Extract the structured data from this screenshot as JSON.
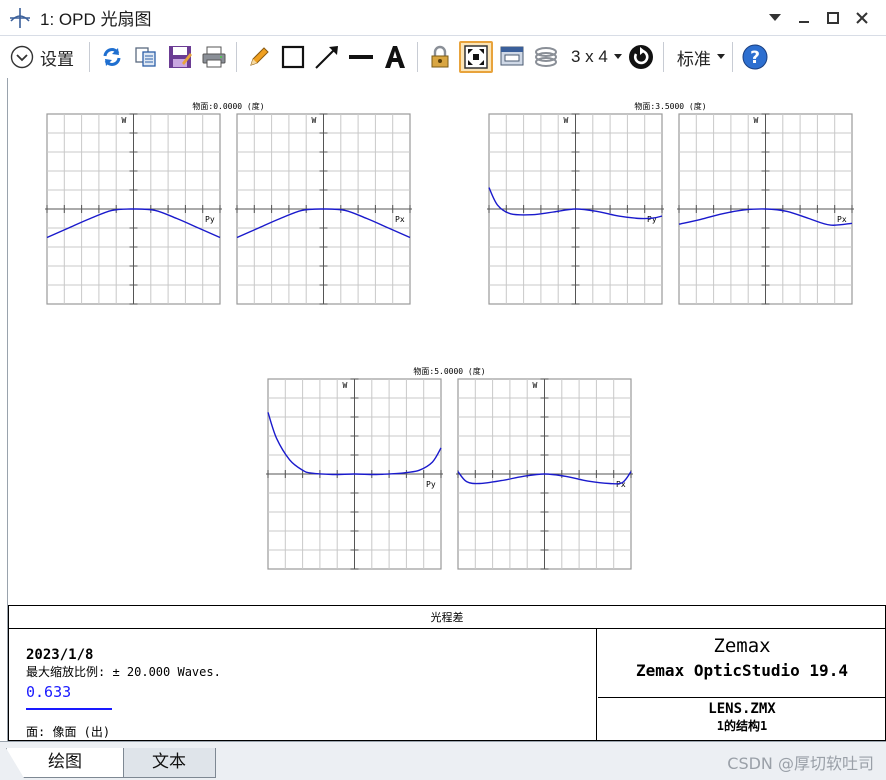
{
  "window": {
    "title": "1: OPD 光扇图"
  },
  "toolbar": {
    "settings_label": "设置",
    "layout_label": "3 x 4",
    "standard_label": "标准",
    "icons": [
      "refresh-icon",
      "copy-icon",
      "save-icon",
      "print-icon",
      "pencil-icon",
      "rectangle-icon",
      "arrow-icon",
      "line-icon",
      "text-icon",
      "lock-icon",
      "window-fit-icon",
      "window-icon",
      "layers-icon",
      "layout-dropdown",
      "rotate-icon",
      "standard-dropdown",
      "help-icon"
    ]
  },
  "fields": [
    {
      "title": "物面:0.0000 (度)",
      "tangential_label": "Py",
      "sagittal_label": "Px",
      "axis_label": "W"
    },
    {
      "title": "物面:3.5000 (度)",
      "tangential_label": "Py",
      "sagittal_label": "Px",
      "axis_label": "W"
    },
    {
      "title": "物面:5.0000 (度)",
      "tangential_label": "Py",
      "sagittal_label": "Px",
      "axis_label": "W"
    }
  ],
  "chart_data": [
    {
      "type": "line",
      "title": "物面:0.0000 (度)",
      "panels": [
        {
          "name": "Py",
          "x": [
            -1,
            -0.75,
            -0.5,
            -0.25,
            0,
            0.25,
            0.5,
            0.75,
            1
          ],
          "y": [
            -6,
            -4,
            -2,
            -0.3,
            0,
            -0.3,
            -2,
            -4,
            -6
          ]
        },
        {
          "name": "Px",
          "x": [
            -1,
            -0.75,
            -0.5,
            -0.25,
            0,
            0.25,
            0.5,
            0.75,
            1
          ],
          "y": [
            -6,
            -4,
            -2,
            -0.3,
            0,
            -0.3,
            -2,
            -4,
            -6
          ]
        }
      ],
      "xlim": [
        -1,
        1
      ],
      "ylim": [
        -20,
        20
      ],
      "ylabel": "W"
    },
    {
      "type": "line",
      "title": "物面:3.5000 (度)",
      "panels": [
        {
          "name": "Py",
          "x": [
            -1,
            -0.9,
            -0.75,
            -0.5,
            -0.25,
            0,
            0.25,
            0.5,
            0.75,
            0.9,
            1
          ],
          "y": [
            4.5,
            0.8,
            -1,
            -1.2,
            -0.6,
            0,
            -0.5,
            -1.5,
            -2,
            -1.9,
            -1.5
          ]
        },
        {
          "name": "Px",
          "x": [
            -1,
            -0.75,
            -0.5,
            -0.25,
            0,
            0.25,
            0.5,
            0.75,
            1
          ],
          "y": [
            -3.2,
            -2.2,
            -1,
            -0.2,
            0,
            -0.5,
            -2,
            -3.4,
            -3
          ]
        }
      ],
      "xlim": [
        -1,
        1
      ],
      "ylim": [
        -20,
        20
      ],
      "ylabel": "W"
    },
    {
      "type": "line",
      "title": "物面:5.0000 (度)",
      "panels": [
        {
          "name": "Py",
          "x": [
            -1,
            -0.9,
            -0.75,
            -0.6,
            -0.5,
            -0.25,
            0,
            0.25,
            0.5,
            0.6,
            0.75,
            0.9,
            1
          ],
          "y": [
            13,
            7.5,
            3,
            0.8,
            0.2,
            -0.1,
            0,
            -0.1,
            0.1,
            0.3,
            0.8,
            2.5,
            5.5
          ]
        },
        {
          "name": "Px",
          "x": [
            -1,
            -0.9,
            -0.75,
            -0.5,
            -0.25,
            0,
            0.25,
            0.5,
            0.75,
            0.9,
            1
          ],
          "y": [
            0.5,
            -1.6,
            -2,
            -1.4,
            -0.5,
            0,
            -0.5,
            -1.5,
            -2,
            -1.8,
            0.5
          ]
        }
      ],
      "xlim": [
        -1,
        1
      ],
      "ylim": [
        -20,
        20
      ],
      "ylabel": "W"
    }
  ],
  "footer": {
    "title": "光程差",
    "date": "2023/1/8",
    "scale": "最大缩放比例: ± 20.000 Waves.",
    "wavelength": "0.633",
    "surface": "面: 像面 (出)",
    "brand": "Zemax",
    "product": "Zemax OpticStudio 19.4",
    "lens_file": "LENS.ZMX",
    "config": "1的结构1"
  },
  "tabs": {
    "plot": "绘图",
    "text": "文本"
  },
  "watermark": "CSDN @厚切软吐司",
  "colors": {
    "curve": "#1a1acc",
    "grid": "#c8c8c8",
    "accent": "#1a1aff"
  }
}
